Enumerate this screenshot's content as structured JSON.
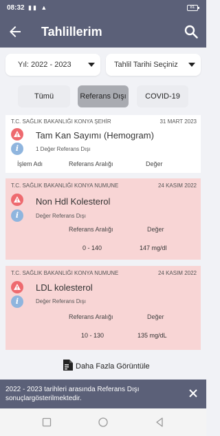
{
  "status_bar": {
    "time": "08:32",
    "signal": "▮▮ ▲",
    "battery": "81"
  },
  "app_bar": {
    "title": "Tahlillerim",
    "back_icon": "arrow-back-icon",
    "search_icon": "search-icon"
  },
  "filters": {
    "year": {
      "label": "Yıl: 2022 - 2023"
    },
    "date": {
      "label": "Tahlil Tarihi Seçiniz"
    }
  },
  "chips": [
    {
      "label": "Tümü",
      "active": false
    },
    {
      "label": "Referans Dışı",
      "active": true
    },
    {
      "label": "COVID-19",
      "active": false
    }
  ],
  "cards": [
    {
      "institution": "T.C. SAĞLIK BAKANLIĞI KONYA ŞEHİR",
      "date": "31 MART 2023",
      "name": "Tam Kan Sayımı (Hemogram)",
      "sub": "1 Değer Referans Dışı",
      "headers": [
        "İşlem Adı",
        "Referans Aralığı",
        "Değer"
      ],
      "color": "#ffffff"
    },
    {
      "institution": "T.C. SAĞLIK BAKANLIĞI KONYA NUMUNE",
      "date": "24 KASIM 2022",
      "name": "Non Hdl Kolesterol",
      "sub": "Değer Referans Dışı",
      "headers": [
        "Referans Aralığı",
        "Değer"
      ],
      "range": "0 - 140",
      "value": "147 mg/dl",
      "color": "#f8d5d5"
    },
    {
      "institution": "T.C. SAĞLIK BAKANLIĞI KONYA NUMUNE",
      "date": "24 KASIM 2022",
      "name": "LDL kolesterol",
      "sub": "Değer Referans Dışı",
      "headers": [
        "Referans Aralığı",
        "Değer"
      ],
      "range": "10 - 130",
      "value": "135 mg/dL",
      "color": "#f8d5d5"
    }
  ],
  "show_more": {
    "label": "Daha Fazla Görüntüle",
    "icon": "note-add-icon"
  },
  "snackbar": {
    "message": "2022 - 2023 tarihleri arasında Referans Dışı sonuçlargösterilmektedir."
  },
  "colors": {
    "primary": "#5b6078",
    "warning": "#ee6a6f",
    "info": "#8fb5de",
    "out_of_range": "#f8d5d5"
  }
}
